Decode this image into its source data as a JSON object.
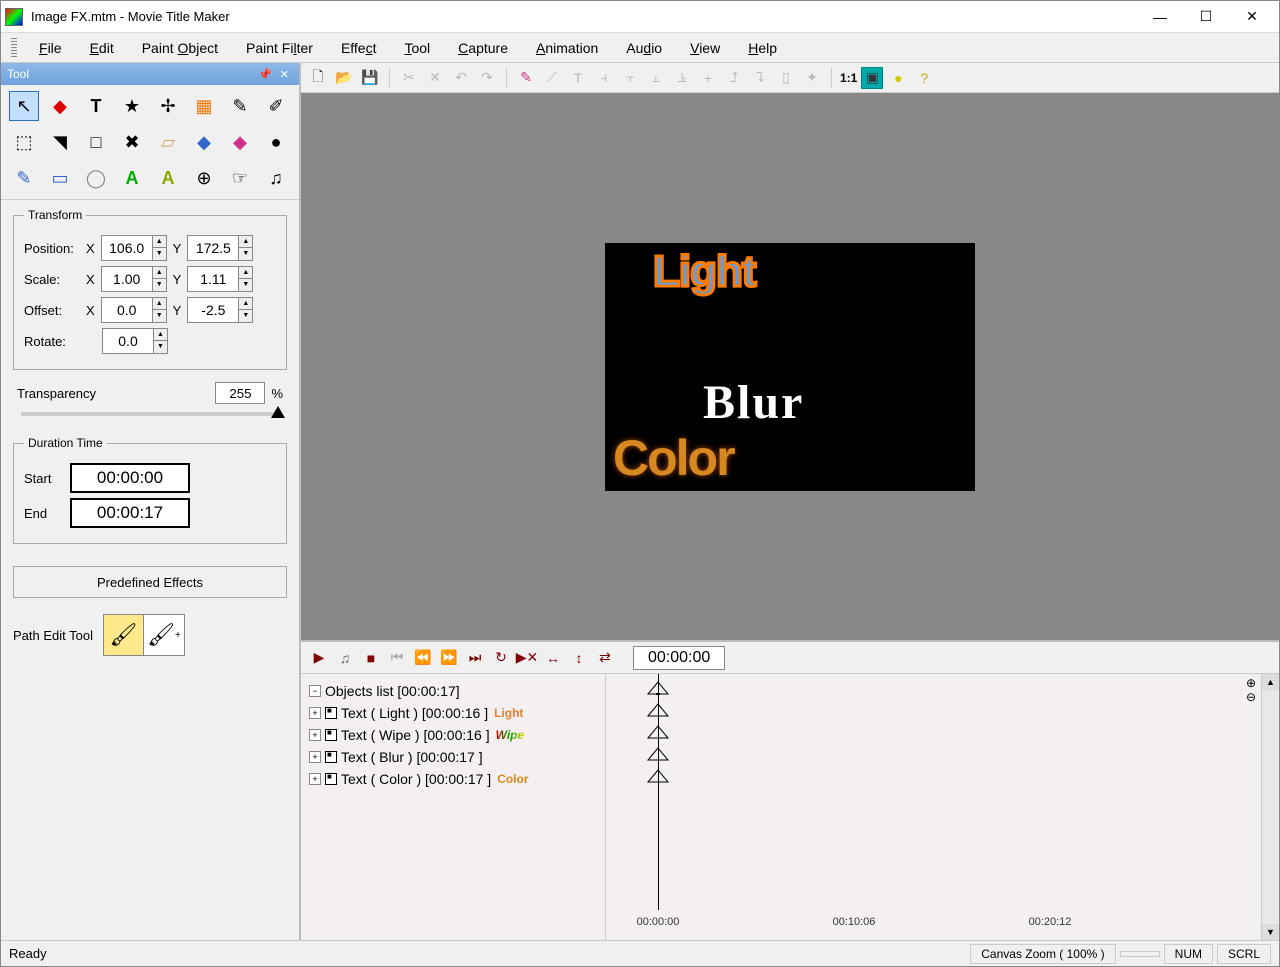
{
  "window": {
    "title": "Image FX.mtm - Movie Title Maker"
  },
  "menu": [
    "File",
    "Edit",
    "Paint Object",
    "Paint Filter",
    "Effect",
    "Tool",
    "Capture",
    "Animation",
    "Audio",
    "View",
    "Help"
  ],
  "panel": {
    "title": "Tool"
  },
  "tools_row1": [
    "↖",
    "◆",
    "T",
    "★",
    "✢",
    "▦",
    "✎",
    "✐"
  ],
  "tools_row2": [
    "⬚",
    "▶",
    "□",
    "✖",
    "◧",
    "◆",
    "◆",
    "●"
  ],
  "tools_row3": [
    "✎",
    "▭",
    "◯",
    "A",
    "A",
    "⊕",
    "☞",
    "♫"
  ],
  "transform": {
    "legend": "Transform",
    "pos_label": "Position:",
    "pos_x": "106.0",
    "pos_y": "172.5",
    "scale_label": "Scale:",
    "scale_x": "1.00",
    "scale_y": "1.11",
    "offset_label": "Offset:",
    "offset_x": "0.0",
    "offset_y": "-2.5",
    "rotate_label": "Rotate:",
    "rotate": "0.0"
  },
  "transparency": {
    "label": "Transparency",
    "value": "255",
    "unit": "%"
  },
  "duration": {
    "legend": "Duration Time",
    "start_label": "Start",
    "start": "00:00:00",
    "end_label": "End",
    "end": "00:00:17"
  },
  "predef_label": "Predefined Effects",
  "path_tool_label": "Path Edit Tool",
  "main_toolbar": {
    "ratio": "1:1"
  },
  "canvas": {
    "light": "Light",
    "blur": "Blur",
    "color": "Color"
  },
  "playback": {
    "time": "00:00:00"
  },
  "objects": {
    "header": "Objects list [00:00:17]",
    "items": [
      {
        "label": "Text ( Light ) [00:00:16 ]",
        "preview": "Light",
        "cls": "light"
      },
      {
        "label": "Text ( Wipe ) [00:00:16 ]",
        "preview": "Wipe",
        "cls": "wipe"
      },
      {
        "label": "Text ( Blur ) [00:00:17 ]",
        "preview": "",
        "cls": ""
      },
      {
        "label": "Text ( Color ) [00:00:17 ]",
        "preview": "Color",
        "cls": "color"
      }
    ]
  },
  "ruler": [
    "00:00:00",
    "00:10:06",
    "00:20:12"
  ],
  "status": {
    "ready": "Ready",
    "zoom": "Canvas Zoom ( 100% )",
    "num": "NUM",
    "scrl": "SCRL"
  }
}
